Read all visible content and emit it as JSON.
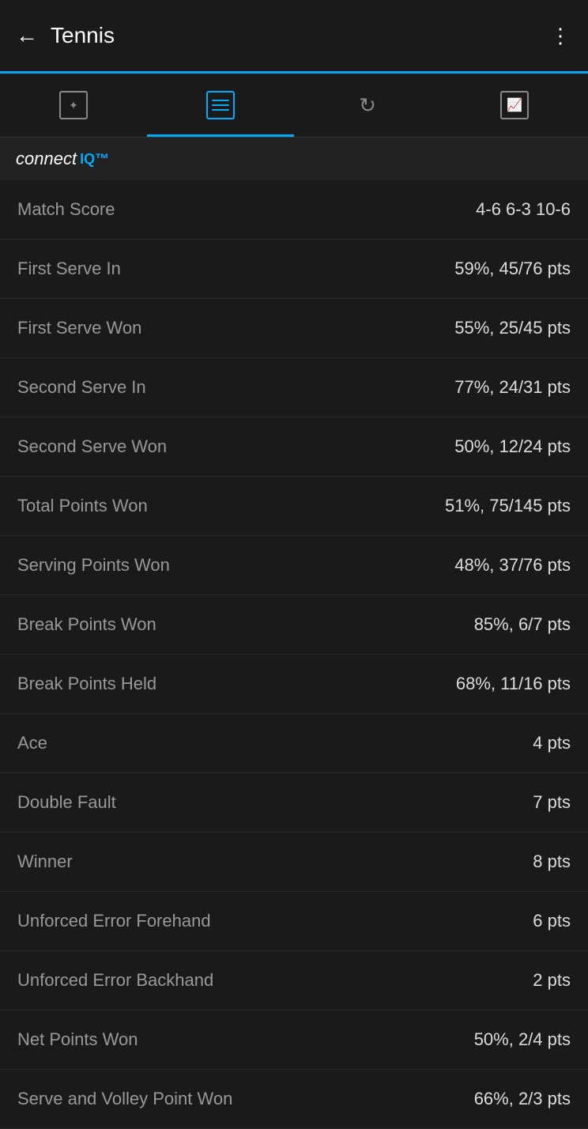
{
  "header": {
    "title": "Tennis",
    "back_label": "←",
    "menu_label": "⋮"
  },
  "tabs": [
    {
      "id": "activity",
      "label": "Activity",
      "active": false
    },
    {
      "id": "list",
      "label": "List",
      "active": true
    },
    {
      "id": "repeat",
      "label": "Repeat",
      "active": false
    },
    {
      "id": "chart",
      "label": "Chart",
      "active": false
    }
  ],
  "connect_iq": {
    "text": "connect",
    "suffix": "IQ™"
  },
  "stats": [
    {
      "label": "Match Score",
      "value": "4-6 6-3 10-6"
    },
    {
      "label": "First Serve In",
      "value": "59%, 45/76 pts"
    },
    {
      "label": "First Serve Won",
      "value": "55%, 25/45 pts"
    },
    {
      "label": "Second Serve In",
      "value": "77%, 24/31 pts"
    },
    {
      "label": "Second Serve Won",
      "value": "50%, 12/24 pts"
    },
    {
      "label": "Total Points Won",
      "value": "51%, 75/145 pts"
    },
    {
      "label": "Serving Points Won",
      "value": "48%, 37/76 pts"
    },
    {
      "label": "Break Points Won",
      "value": "85%, 6/7 pts"
    },
    {
      "label": "Break Points Held",
      "value": "68%, 11/16 pts"
    },
    {
      "label": "Ace",
      "value": "4 pts"
    },
    {
      "label": "Double Fault",
      "value": "7 pts"
    },
    {
      "label": "Winner",
      "value": "8 pts"
    },
    {
      "label": "Unforced Error Forehand",
      "value": "6 pts"
    },
    {
      "label": "Unforced Error Backhand",
      "value": "2 pts"
    },
    {
      "label": "Net Points Won",
      "value": "50%, 2/4 pts"
    },
    {
      "label": "Serve and Volley Point Won",
      "value": "66%, 2/3 pts"
    }
  ]
}
